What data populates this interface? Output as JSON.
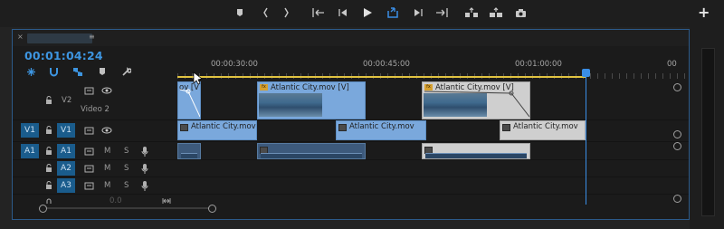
{
  "sequence": {
    "timecode": "00:01:04:24",
    "tab_close": "×",
    "tab_menu": "≡"
  },
  "ruler": {
    "labels": [
      "00:00:30:00",
      "00:00:45:00",
      "00:01:00:00",
      "00"
    ]
  },
  "transport": {
    "buttons": [
      "add-marker-icon",
      "mark-in-icon",
      "mark-out-icon",
      "go-to-in-icon",
      "step-back-icon",
      "play-icon",
      "loop-icon",
      "step-forward-icon",
      "go-to-out-icon",
      "lift-icon",
      "extract-icon",
      "export-frame-icon"
    ],
    "plus": "+"
  },
  "tracks": {
    "v2": {
      "label": "V2",
      "name": "Video 2"
    },
    "v1": {
      "source": "V1",
      "label": "V1"
    },
    "a1": {
      "source": "A1",
      "label": "A1",
      "m": "M",
      "s": "S"
    },
    "a2": {
      "label": "A2",
      "m": "M",
      "s": "S"
    },
    "a3": {
      "label": "A3",
      "m": "M",
      "s": "S"
    },
    "master": {
      "value": "0.0"
    }
  },
  "clips": {
    "v2_a": "fx  Atlantic City.mov [V]",
    "v2_b": "Atlantic City.mov [V]",
    "v2_c": "Atlantic City.mov [V]",
    "v2_a_short": "ov [V]",
    "v1_a": "Atlantic City.mov",
    "v1_b": "Atlantic City.mov",
    "v1_c": "Atlantic City.mov"
  },
  "colors": {
    "accent": "#3a8ee6",
    "work_area": "#e0c341",
    "video_clip": "#7aa8dc",
    "audio_clip": "#3d5a7c",
    "selected_clip": "#cfcfcf"
  }
}
